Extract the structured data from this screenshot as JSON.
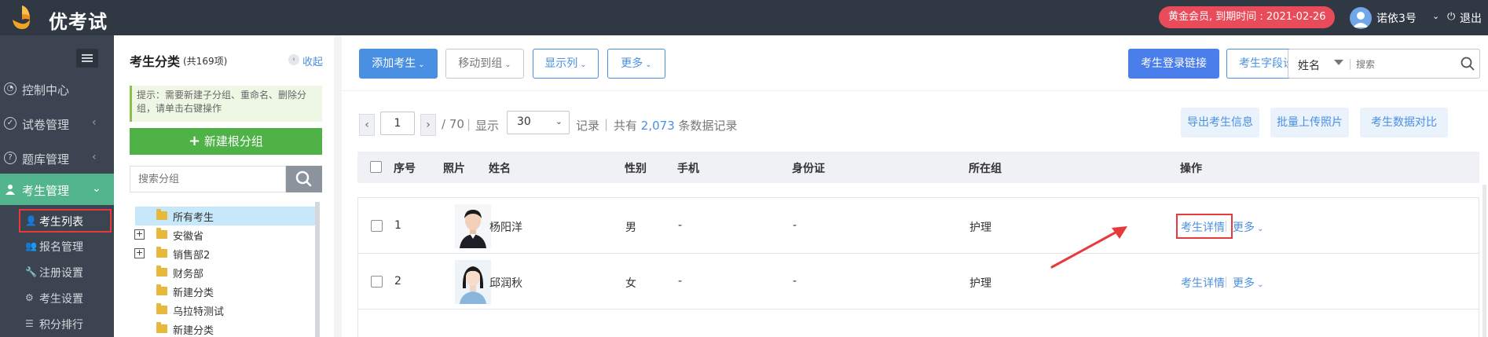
{
  "header": {
    "brand": "优考试",
    "member_badge": "黄金会员, 到期时间 : 2021-02-26",
    "user_name": "诺依3号",
    "logout": "退出",
    "brand_color": "#303843",
    "badge_color": "#ea4b5a"
  },
  "sidebar": {
    "toggle_icon": "hamburger-icon",
    "items": [
      {
        "label": "控制中心",
        "icon": "dashboard-icon",
        "chevron": ""
      },
      {
        "label": "试卷管理",
        "icon": "check-circle-icon",
        "chevron": "‹"
      },
      {
        "label": "题库管理",
        "icon": "question-circle-icon",
        "chevron": "‹"
      },
      {
        "label": "考生管理",
        "icon": "user-icon",
        "chevron": "⌄"
      }
    ],
    "sub_items": [
      {
        "label": "考生列表",
        "icon": "user-list-icon"
      },
      {
        "label": "报名管理",
        "icon": "user-plus-icon"
      },
      {
        "label": "注册设置",
        "icon": "wrench-icon"
      },
      {
        "label": "考生设置",
        "icon": "gear-icon"
      },
      {
        "label": "积分排行",
        "icon": "ranking-icon"
      }
    ],
    "active_color": "#53b58d"
  },
  "category": {
    "title": "考生分类",
    "count": "(共169项)",
    "collapse": "收起",
    "tip": "提示：需要新建子分组、重命名、删除分组，请单击右键操作",
    "new_root": "新建根分组",
    "search_placeholder": "搜索分组",
    "tree": [
      {
        "label": "所有考生",
        "expandable": false,
        "selected": true
      },
      {
        "label": "安徽省",
        "expandable": true,
        "selected": false
      },
      {
        "label": "销售部2",
        "expandable": true,
        "selected": false
      },
      {
        "label": "财务部",
        "expandable": false,
        "selected": false
      },
      {
        "label": "新建分类",
        "expandable": false,
        "selected": false
      },
      {
        "label": "乌拉特测试",
        "expandable": false,
        "selected": false
      },
      {
        "label": "新建分类",
        "expandable": false,
        "selected": false
      }
    ]
  },
  "toolbar": {
    "add_student": "添加考生",
    "move_group": "移动到组",
    "show_columns": "显示列",
    "more": "更多",
    "login_link": "考生登录链接",
    "field_settings": "考生字段设置",
    "search_field": "姓名",
    "search_placeholder": "搜索"
  },
  "pagination": {
    "prev": "‹",
    "next": "›",
    "current_page": "1",
    "total_pages": "/ 70",
    "show_label": "显示",
    "page_size": "30",
    "records_label": "记录",
    "total_prefix": "共有",
    "total_count": "2,073",
    "total_suffix": "条数据记录"
  },
  "actions": {
    "export": "导出考生信息",
    "upload_photos": "批量上传照片",
    "compare": "考生数据对比"
  },
  "table": {
    "columns": [
      "序号",
      "照片",
      "姓名",
      "性别",
      "手机",
      "身份证",
      "所在组",
      "操作"
    ],
    "rows": [
      {
        "index": "1",
        "name": "杨阳洋",
        "gender": "男",
        "phone": "-",
        "id_card": "-",
        "group": "护理",
        "detail": "考生详情",
        "more": "更多"
      },
      {
        "index": "2",
        "name": "邱润秋",
        "gender": "女",
        "phone": "-",
        "id_card": "-",
        "group": "护理",
        "detail": "考生详情",
        "more": "更多"
      }
    ]
  }
}
